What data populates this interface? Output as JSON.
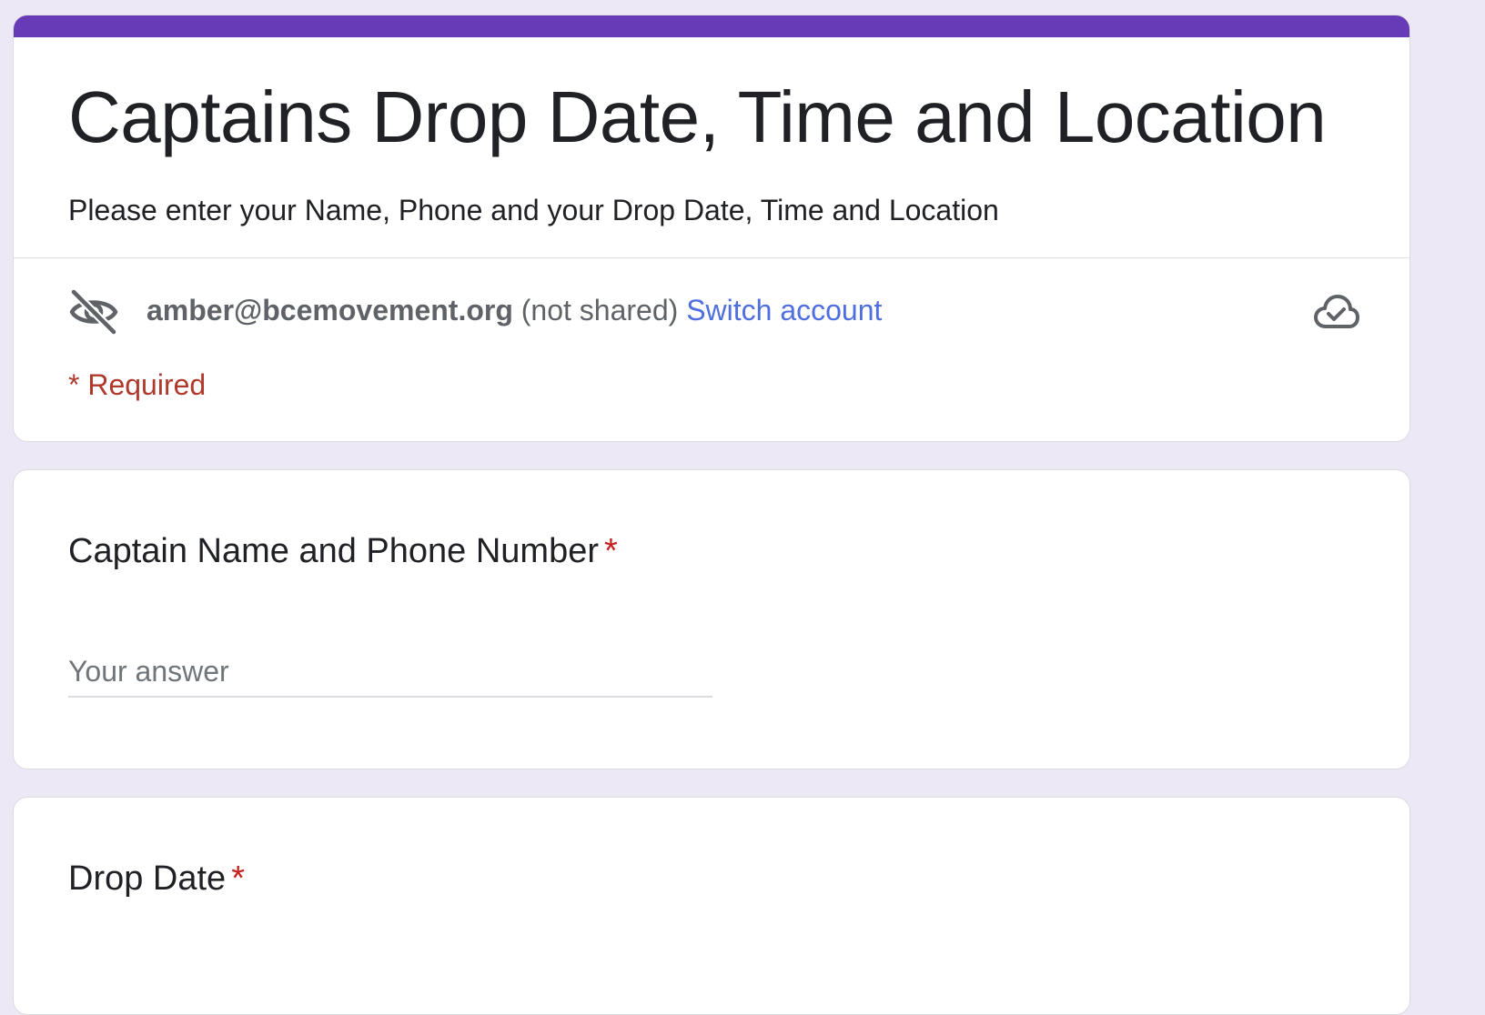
{
  "form": {
    "title": "Captains Drop Date, Time and Location",
    "description": "Please enter your Name, Phone and your Drop Date, Time and Location",
    "accent_color": "#673ab7"
  },
  "account": {
    "email": "amber@bcemovement.org",
    "status": "(not shared)",
    "switch_label": "Switch account",
    "hidden_icon": "eye-off-icon",
    "saved_icon": "cloud-done-icon"
  },
  "required_note": "* Required",
  "questions": [
    {
      "title": "Captain Name and Phone Number",
      "required_mark": "*",
      "placeholder": "Your answer"
    },
    {
      "title": "Drop Date",
      "required_mark": "*"
    }
  ]
}
